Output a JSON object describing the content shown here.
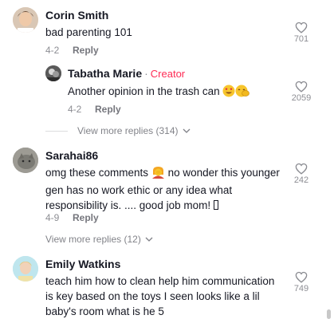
{
  "comments": [
    {
      "name": "Corin Smith",
      "text": "bad parenting 101",
      "date": "4-2",
      "reply_label": "Reply",
      "likes": "701"
    },
    {
      "name": "Tabatha Marie",
      "badge": "Creator",
      "text": "Another opinion in the trash can ",
      "date": "4-2",
      "reply_label": "Reply",
      "likes": "2059"
    },
    {
      "name": "Sarahai86",
      "text_part1": "omg these comments ",
      "text_part2": " no wonder this younger gen has no work ethic or any idea what responsibility is. .... good job mom! ",
      "date": "4-9",
      "reply_label": "Reply",
      "likes": "242"
    },
    {
      "name": "Emily Watkins",
      "text": "teach him how to clean help him communication is key based on the toys I seen looks like a lil baby's room what is he 5",
      "likes": "749"
    }
  ],
  "view_more_1": "View more replies (314)",
  "view_more_2": "View more replies (12)",
  "icons": {
    "like": "heart-outline-icon",
    "chevron": "chevron-down-icon"
  },
  "colors": {
    "creator": "#fe2c55",
    "text": "#161823"
  }
}
